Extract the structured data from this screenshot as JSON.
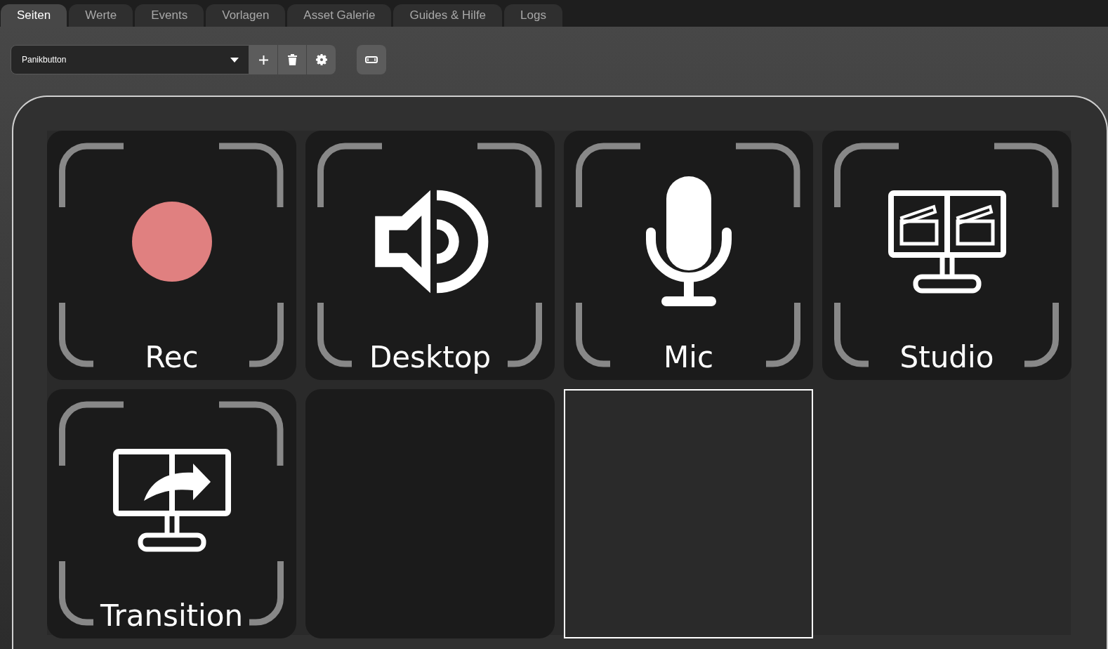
{
  "tabs": [
    {
      "label": "Seiten",
      "selected": true
    },
    {
      "label": "Werte",
      "selected": false
    },
    {
      "label": "Events",
      "selected": false
    },
    {
      "label": "Vorlagen",
      "selected": false
    },
    {
      "label": "Asset Galerie",
      "selected": false
    },
    {
      "label": "Guides & Hilfe",
      "selected": false
    },
    {
      "label": "Logs",
      "selected": false
    }
  ],
  "page_select": {
    "value": "Panikbutton"
  },
  "grid": [
    {
      "kind": "button",
      "label": "Rec",
      "selected": false
    },
    {
      "kind": "button",
      "label": "Desktop",
      "selected": false
    },
    {
      "kind": "button",
      "label": "Mic",
      "selected": false
    },
    {
      "kind": "button",
      "label": "Studio",
      "selected": false
    },
    {
      "kind": "button",
      "label": "Transition",
      "selected": false
    },
    {
      "kind": "empty",
      "selected": false
    },
    {
      "kind": "empty",
      "selected": true
    }
  ]
}
